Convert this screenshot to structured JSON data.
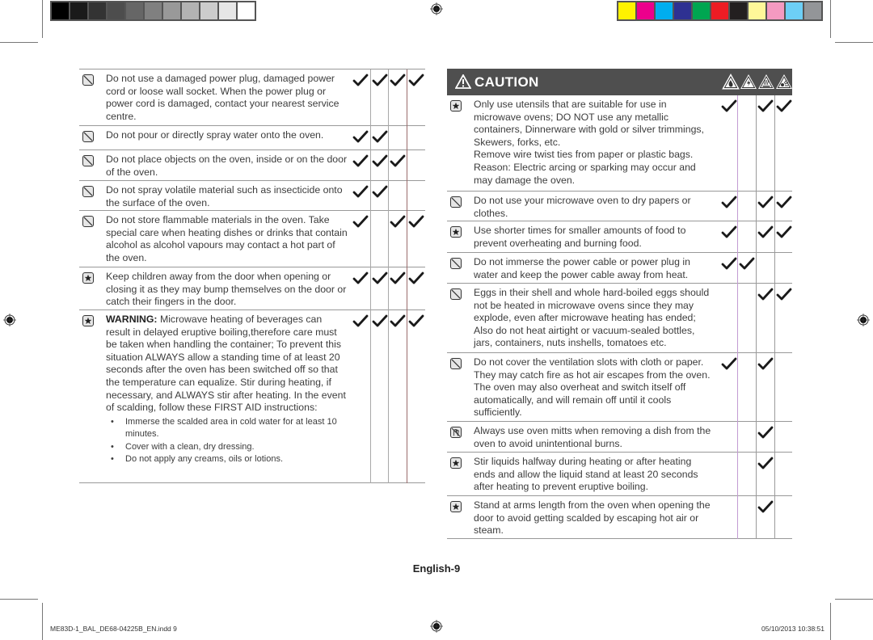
{
  "print_marks": {
    "gray_swatches": [
      "#000000",
      "#1a1a1a",
      "#333333",
      "#4d4d4d",
      "#666666",
      "#808080",
      "#999999",
      "#b3b3b3",
      "#cccccc",
      "#e6e6e6",
      "#ffffff"
    ],
    "color_swatches": [
      "#fff200",
      "#ec008c",
      "#00aeef",
      "#2e3192",
      "#00a651",
      "#ed1c24",
      "#231f20",
      "#fff799",
      "#f49ac1",
      "#6dcff6",
      "#939598"
    ]
  },
  "left_table": {
    "rows": [
      {
        "icon": "prohibited-icon",
        "text": "Do not use a damaged power plug, damaged power cord or loose wall socket. When the power plug or power cord is damaged, contact your nearest service centre.",
        "checks": [
          true,
          true,
          true,
          true
        ]
      },
      {
        "icon": "prohibited-icon",
        "text": "Do not pour or directly spray water onto the oven.",
        "checks": [
          true,
          true,
          false,
          false
        ]
      },
      {
        "icon": "prohibited-icon",
        "text": "Do not place objects on the oven, inside or on the door of the oven.",
        "checks": [
          true,
          true,
          true,
          false
        ]
      },
      {
        "icon": "prohibited-icon",
        "text": "Do not spray volatile material such as insecticide onto the surface of the oven.",
        "checks": [
          true,
          true,
          false,
          false
        ]
      },
      {
        "icon": "prohibited-icon",
        "text": "Do not store flammable materials in the oven. Take special care when heating dishes or drinks that contain alcohol as alcohol vapours may contact a hot part of the oven.",
        "checks": [
          true,
          false,
          true,
          true
        ]
      },
      {
        "icon": "star-icon",
        "text": "Keep children away from the door when opening or closing it as they may bump themselves on the door or catch their fingers in the door.",
        "checks": [
          true,
          true,
          true,
          true
        ]
      },
      {
        "icon": "star-icon",
        "bold_prefix": "WARNING:",
        "text": " Microwave heating of beverages can result in delayed eruptive boiling,therefore care must be taken when handling the container; To prevent this situation ALWAYS allow a standing time of at least 20 seconds after the oven has been switched off so that the temperature can equalize. Stir during heating, if necessary, and ALWAYS stir after heating. In the event of scalding, follow these FIRST AID instructions:",
        "bullets": [
          "Immerse the scalded area in cold water for at least 10 minutes.",
          "Cover with a clean, dry dressing.",
          "Do not apply any creams, oils or lotions."
        ],
        "checks": [
          true,
          true,
          true,
          true
        ]
      }
    ]
  },
  "caution": {
    "title": "CAUTION",
    "header_icons": [
      "fire-hazard-icon",
      "electric-shock-icon",
      "hot-surface-icon",
      "explosion-icon"
    ],
    "rows": [
      {
        "icon": "star-icon",
        "text": "Only use utensils that are suitable for use in microwave ovens; DO NOT use any metallic containers, Dinnerware with gold or silver trimmings, Skewers, forks, etc.\nRemove wire twist ties from paper or plastic bags.\nReason: Electric arcing or sparking may occur and may damage the oven.",
        "checks": [
          true,
          false,
          true,
          true
        ]
      },
      {
        "icon": "prohibited-icon",
        "text": "Do not use your microwave oven to dry papers or clothes.",
        "checks": [
          true,
          false,
          true,
          true
        ]
      },
      {
        "icon": "star-icon",
        "text": "Use shorter times for smaller amounts of food to prevent overheating and burning food.",
        "checks": [
          true,
          false,
          true,
          true
        ]
      },
      {
        "icon": "prohibited-icon",
        "text": "Do not immerse the power cable or power plug in water and keep the power cable away from heat.",
        "checks": [
          true,
          true,
          false,
          false
        ]
      },
      {
        "icon": "prohibited-icon",
        "text": "Eggs in their shell and whole hard-boiled eggs should not be heated in microwave ovens since they may explode, even after microwave heating has ended; Also do not heat airtight or vacuum-sealed bottles, jars, containers, nuts inshells, tomatoes etc.",
        "checks": [
          false,
          false,
          true,
          true
        ]
      },
      {
        "icon": "prohibited-icon",
        "text": "Do not cover the ventilation slots with cloth or paper. They may catch fire as hot air escapes from the oven. The oven may also overheat and switch itself off automatically, and will remain off until it cools sufficiently.",
        "checks": [
          true,
          false,
          true,
          false
        ]
      },
      {
        "icon": "oven-mitt-icon",
        "text": "Always use oven mitts when removing a dish from the oven to avoid unintentional burns.",
        "checks": [
          false,
          false,
          true,
          false
        ]
      },
      {
        "icon": "star-icon",
        "text": "Stir liquids halfway during heating or after heating ends and allow the liquid stand at least 20 seconds after heating to prevent eruptive boiling.",
        "checks": [
          false,
          false,
          true,
          false
        ]
      },
      {
        "icon": "star-icon",
        "text": "Stand at arms length from the oven when opening the door to avoid getting scalded by escaping hot air or steam.",
        "checks": [
          false,
          false,
          true,
          false
        ]
      }
    ]
  },
  "footer": {
    "page_label": "English-9",
    "file_name": "ME83D-1_BAL_DE68-04225B_EN.indd   9",
    "timestamp": "05/10/2013   10:38:51"
  }
}
